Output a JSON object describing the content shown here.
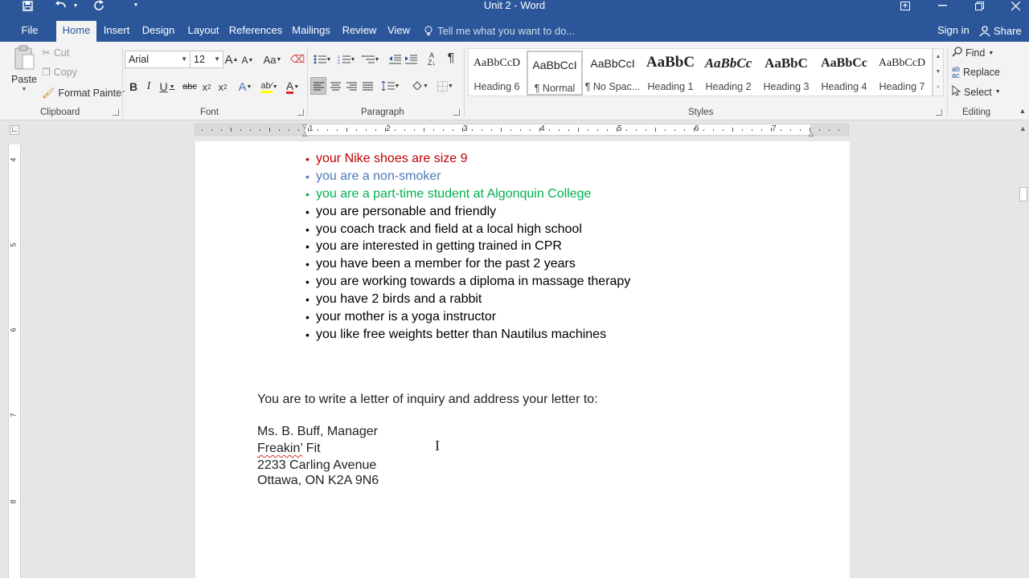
{
  "window": {
    "title": "Unit 2 - Word",
    "quick_access": {
      "save": "save-icon",
      "undo": "undo-icon",
      "redo": "redo-icon",
      "customize": "customize-icon"
    }
  },
  "tabs": [
    "File",
    "Home",
    "Insert",
    "Design",
    "Layout",
    "References",
    "Mailings",
    "Review",
    "View"
  ],
  "active_tab": "Home",
  "tell_me": {
    "placeholder": "Tell me what you want to do..."
  },
  "account": {
    "sign_in": "Sign in",
    "share": "Share"
  },
  "ribbon": {
    "clipboard": {
      "label": "Clipboard",
      "paste": "Paste",
      "cut": "Cut",
      "copy": "Copy",
      "format_painter": "Format Painter"
    },
    "font": {
      "label": "Font",
      "font_name": "Arial",
      "font_size": "12"
    },
    "paragraph": {
      "label": "Paragraph"
    },
    "styles": {
      "label": "Styles",
      "items": [
        {
          "sample": "AaBbCcD",
          "name": "Heading 6"
        },
        {
          "sample": "AaBbCcI",
          "name": "¶ Normal"
        },
        {
          "sample": "AaBbCcI",
          "name": "¶ No Spac..."
        },
        {
          "sample": "AaBbC",
          "name": "Heading 1"
        },
        {
          "sample": "AaBbCc",
          "name": "Heading 2"
        },
        {
          "sample": "AaBbC",
          "name": "Heading 3"
        },
        {
          "sample": "AaBbCc",
          "name": "Heading 4"
        },
        {
          "sample": "AaBbCcD",
          "name": "Heading 7"
        }
      ],
      "selected": "¶ Normal"
    },
    "editing": {
      "label": "Editing",
      "find": "Find",
      "replace": "Replace",
      "select": "Select"
    }
  },
  "ruler": {
    "numbers": [
      "1",
      "2",
      "3",
      "4",
      "5",
      "6",
      "7"
    ],
    "vertical_numbers": [
      "4",
      "5",
      "6",
      "7",
      "8"
    ]
  },
  "colors": {
    "title_bar": "#2b579a",
    "bullet_red": "#c00000",
    "bullet_blue": "#4a7ab5",
    "bullet_green": "#00b050",
    "text": "#000000"
  },
  "document": {
    "bullets": [
      {
        "text": "your Nike shoes are size 9",
        "color": "#c00000"
      },
      {
        "text": "you are a non-smoker",
        "color": "#4a7ab5"
      },
      {
        "text": "you are a part-time student at Algonquin College",
        "color": "#00b050"
      },
      {
        "text": "you are personable and friendly",
        "color": "#000000"
      },
      {
        "text": "you coach track and field at a local high school",
        "color": "#000000"
      },
      {
        "text": "you are interested in getting trained in CPR",
        "color": "#000000"
      },
      {
        "text": "you have been a member for the past 2 years",
        "color": "#000000"
      },
      {
        "text": "you are working towards a diploma in massage therapy",
        "color": "#000000"
      },
      {
        "text": "you have 2 birds and a rabbit",
        "color": "#000000"
      },
      {
        "text": "your mother is a yoga instructor",
        "color": "#000000"
      },
      {
        "text": "you like free weights better than Nautilus machines",
        "color": "#000000"
      }
    ],
    "instruction": "You are to write a letter of inquiry and address your letter to:",
    "address": {
      "line1": "Ms. B. Buff, Manager",
      "line2_word": "Freakin’",
      "line2_rest": " Fit",
      "line3": "2233 Carling Avenue",
      "line4": "Ottawa, ON K2A 9N6"
    }
  }
}
